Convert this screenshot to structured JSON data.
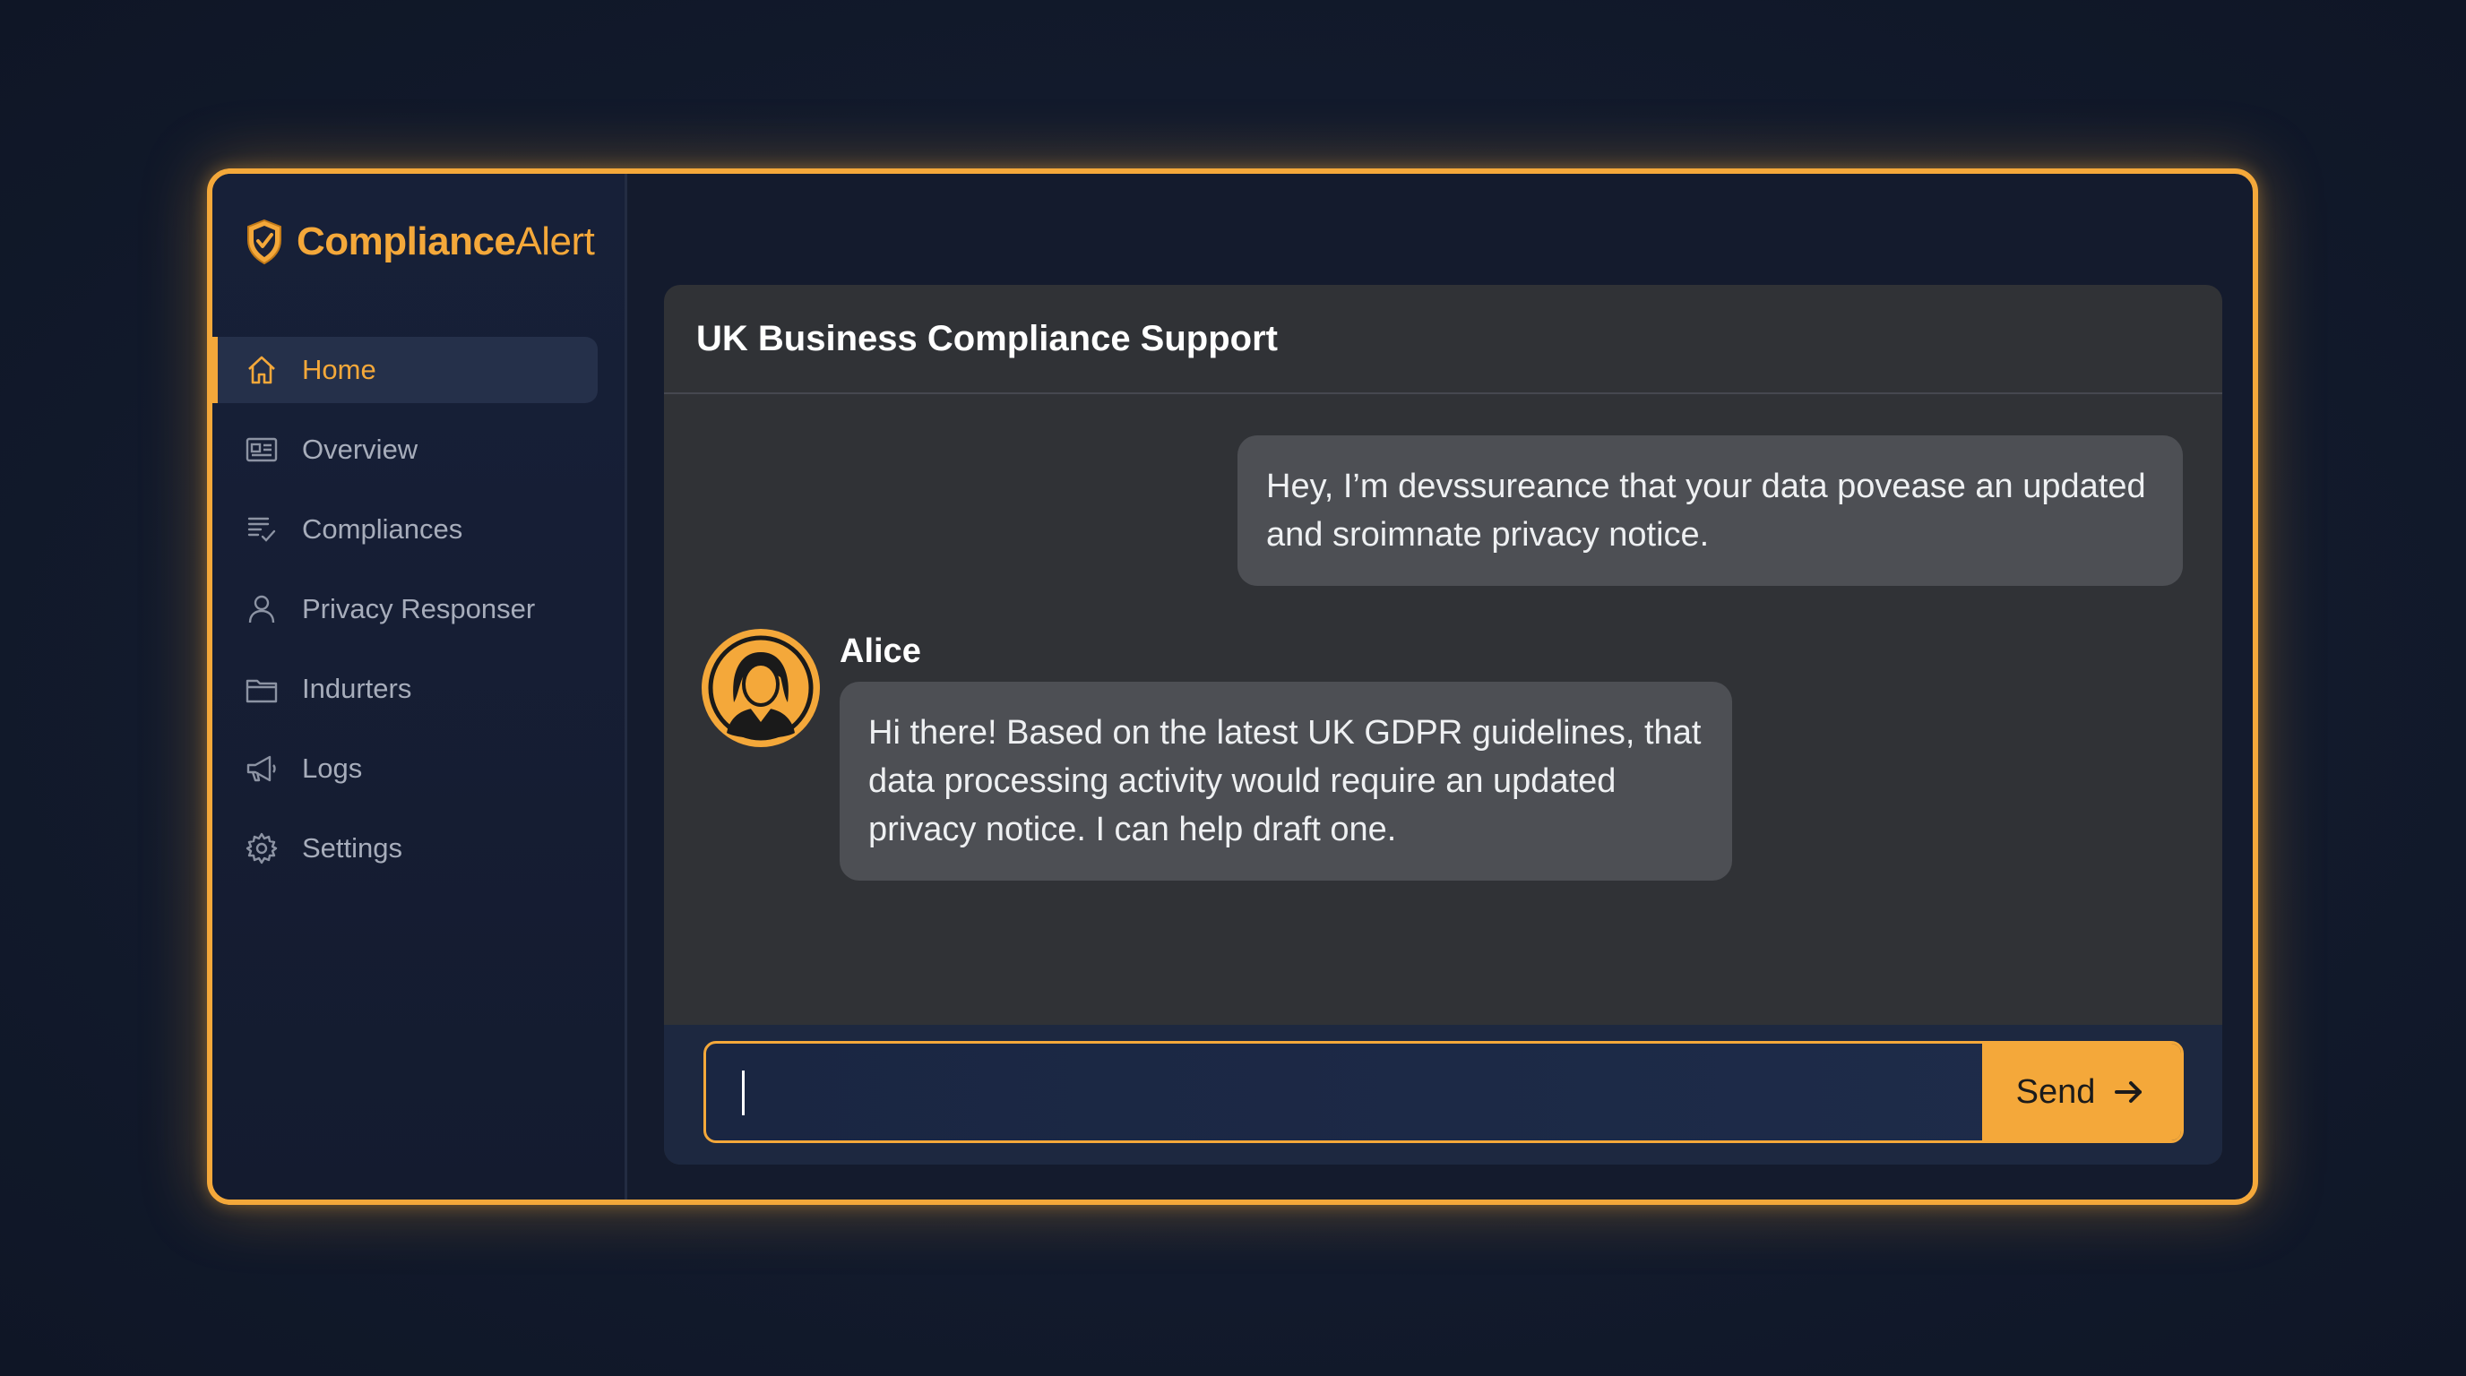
{
  "brand": {
    "name_bold": "Compliance",
    "name_light": "Alert",
    "accent": "#f4a83a",
    "icon": "shield-icon"
  },
  "sidebar": {
    "items": [
      {
        "label": "Home",
        "icon": "home-icon",
        "active": true
      },
      {
        "label": "Overview",
        "icon": "id-card-icon",
        "active": false
      },
      {
        "label": "Compliances",
        "icon": "checklist-icon",
        "active": false
      },
      {
        "label": "Privacy Responser",
        "icon": "user-icon",
        "active": false
      },
      {
        "label": "Indurters",
        "icon": "folder-icon",
        "active": false
      },
      {
        "label": "Logs",
        "icon": "megaphone-icon",
        "active": false
      },
      {
        "label": "Settings",
        "icon": "gear-icon",
        "active": false
      }
    ]
  },
  "chat": {
    "title": "UK Business Compliance Support",
    "messages": [
      {
        "role": "user",
        "text": "Hey, I’m devssureance that your data povease an updated and sroimnate privacy notice."
      },
      {
        "role": "assistant",
        "sender": "Alice",
        "avatar": "avatar-woman-icon",
        "text": "Hi there! Based on the latest UK GDPR guidelines, that data processing activity would require an updated privacy notice. I can help draft one."
      }
    ],
    "input": {
      "value": "",
      "placeholder": ""
    },
    "send_label": "Send",
    "send_icon": "arrow-right-icon"
  }
}
